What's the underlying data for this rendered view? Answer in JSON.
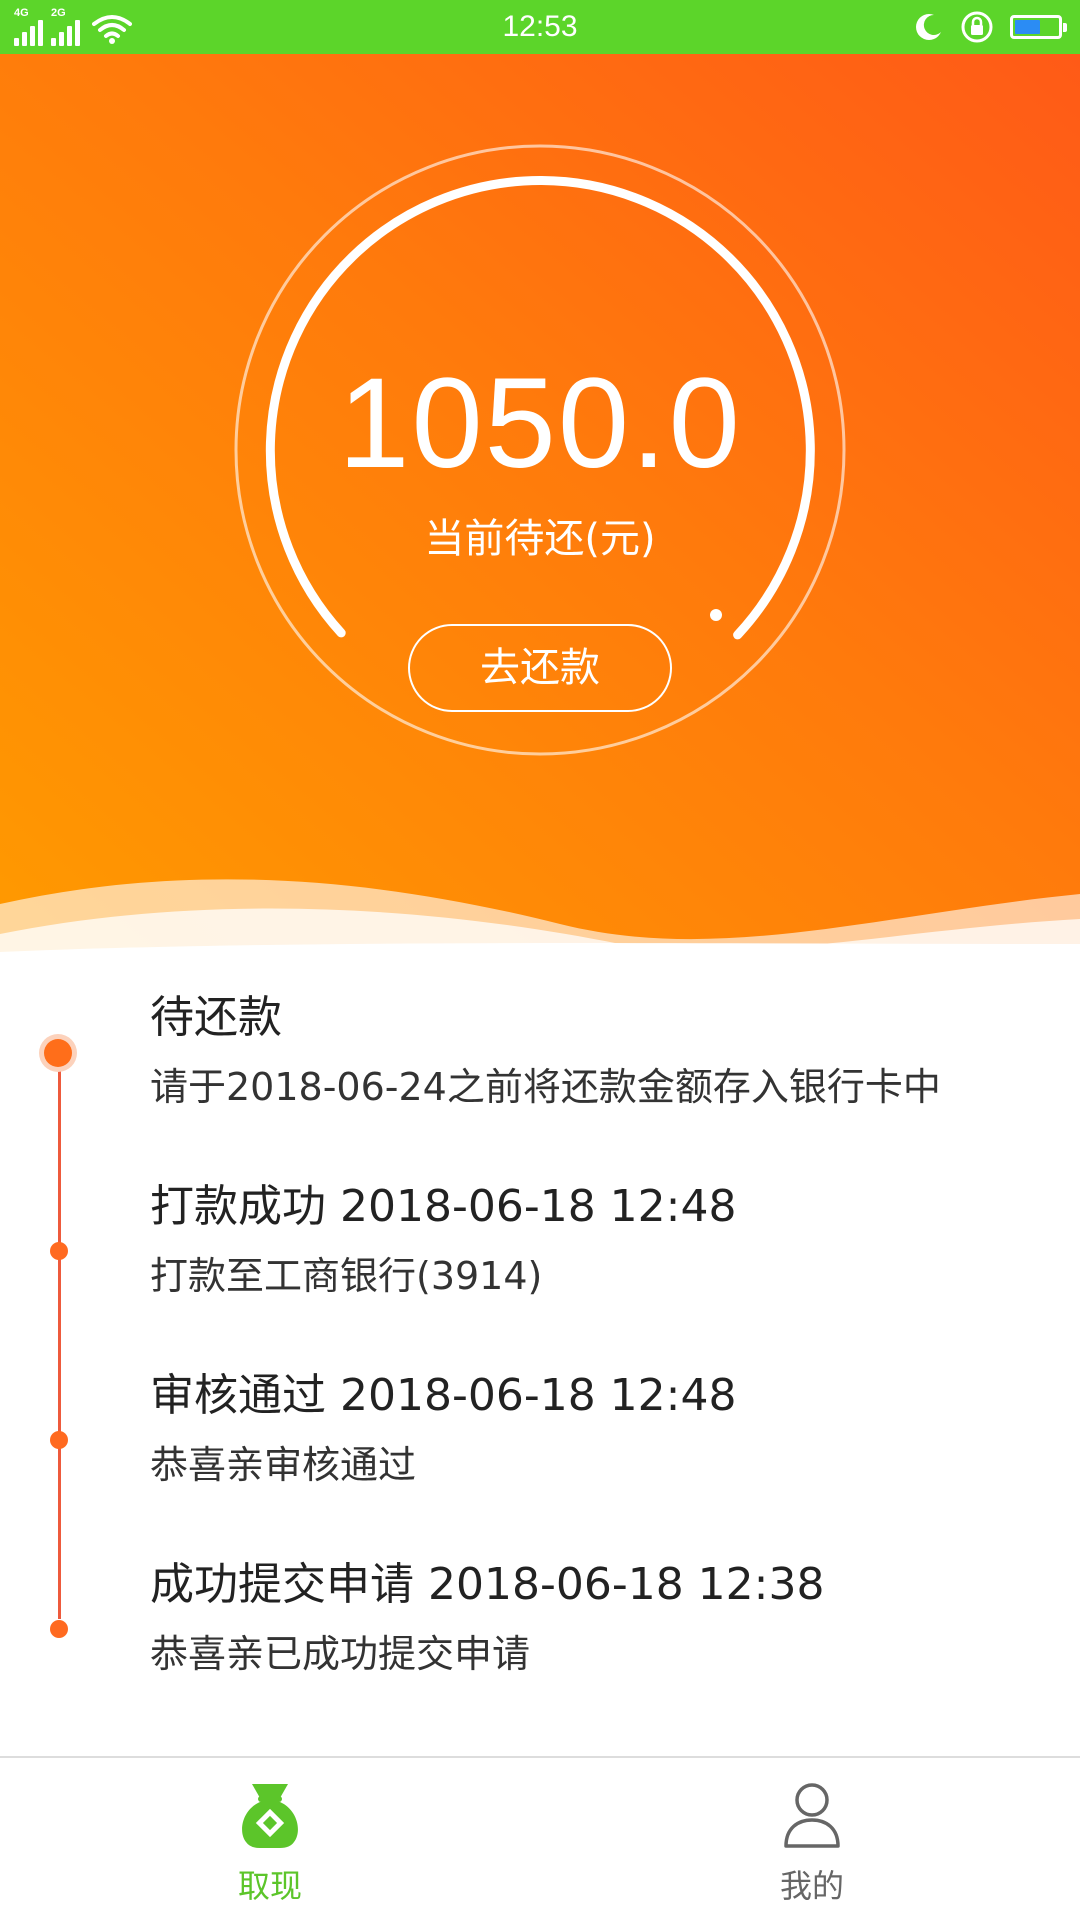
{
  "status_bar": {
    "time": "12:53",
    "network_1": "4G",
    "network_2": "2G",
    "battery_level": 0.6,
    "colors": {
      "background": "#5cd52a",
      "battery_fill": "#2b8cf4"
    }
  },
  "summary": {
    "amount": "1050.0",
    "label": "当前待还(元)",
    "repay_button": "去还款"
  },
  "timeline": [
    {
      "title": "待还款",
      "detail": "请于2018-06-24之前将还款金额存入银行卡中"
    },
    {
      "title": "打款成功 2018-06-18 12:48",
      "detail": "打款至工商银行(3914)"
    },
    {
      "title": "审核通过 2018-06-18 12:48",
      "detail": "恭喜亲审核通过"
    },
    {
      "title": "成功提交申请 2018-06-18 12:38",
      "detail": "恭喜亲已成功提交申请"
    }
  ],
  "bottom_nav": {
    "withdraw": {
      "label": "取现",
      "icon": "money-bag-icon"
    },
    "mine": {
      "label": "我的",
      "icon": "user-icon"
    }
  },
  "colors": {
    "accent": "#ff7a0c",
    "nav_active": "#5cc52a",
    "timeline_line": "#ee5a3c"
  }
}
